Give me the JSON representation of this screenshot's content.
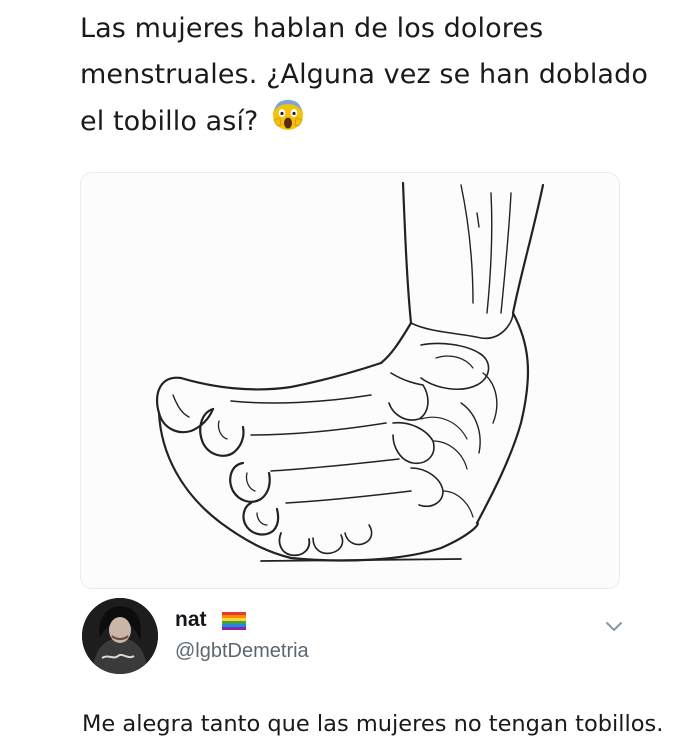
{
  "post": {
    "caption": "Las mujeres hablan de los dolores menstruales. ¿Alguna vez se han doblado el tobillo así?",
    "emoji": "face-screaming-in-fear-emoji"
  },
  "illustration": {
    "subject": "ankle-illustration"
  },
  "tweet": {
    "name": "nat",
    "flag": "rainbow-flag-icon",
    "handle": "@lgbtDemetria",
    "text": "Me alegra tanto que las mujeres no tengan tobillos.",
    "menu_icon": "chevron-down-icon"
  },
  "colors": {
    "handle_gray": "#5b6770",
    "text": "#1a1a1a"
  }
}
